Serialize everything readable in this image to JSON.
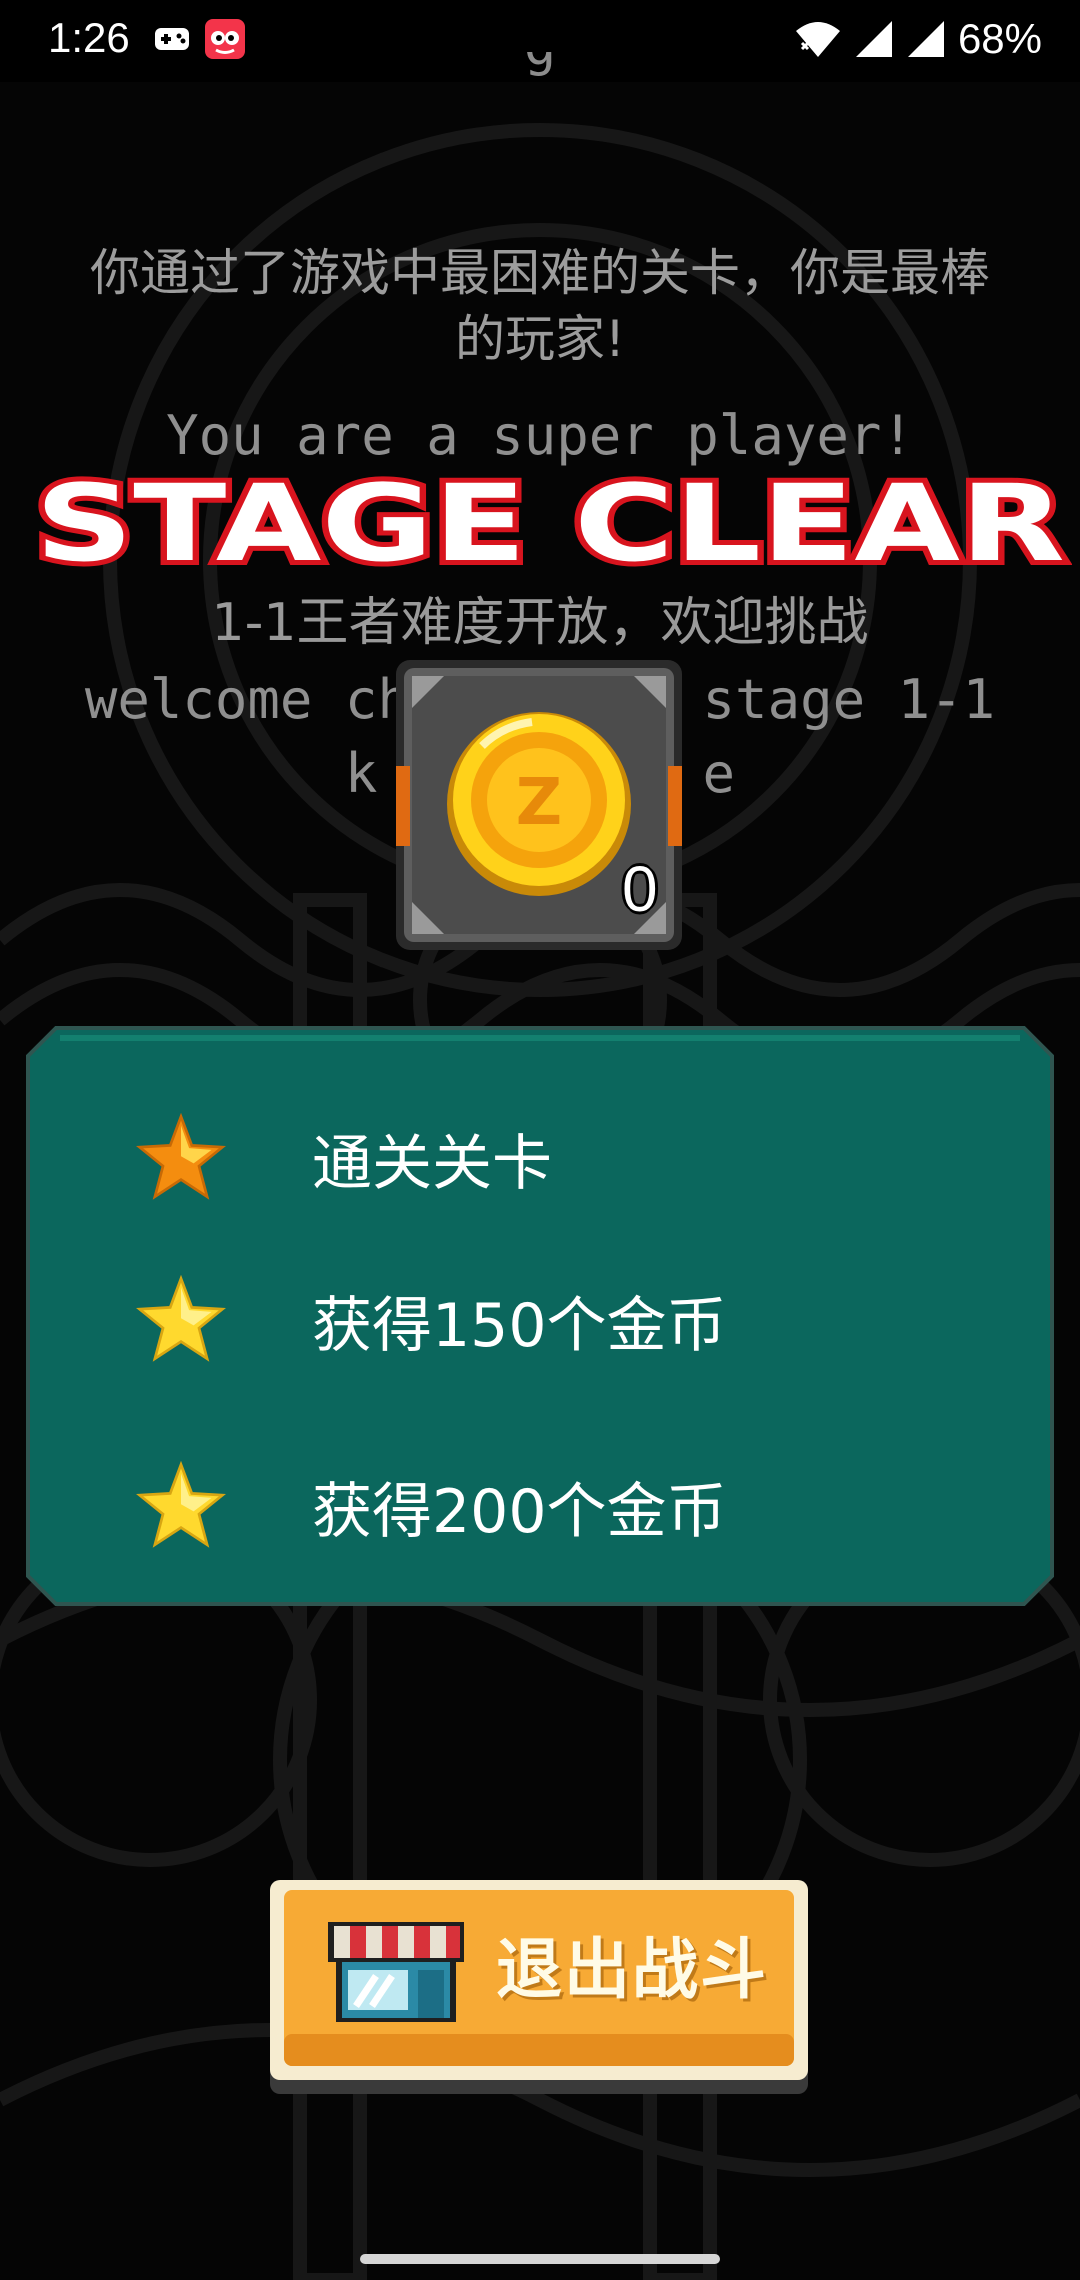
{
  "status_bar": {
    "time": "1:26",
    "battery": "68%"
  },
  "messages": {
    "top_cut": "g",
    "clear_hardest_cn": "你通过了游戏中最困难的关卡，你是最棒的玩家!",
    "super_player_en": "You are a super player!",
    "unlock_cn": "1-1王者难度开放，欢迎挑战",
    "welcome_en": "welcome ch         stage 1-1",
    "welcome_en_2": "k          e"
  },
  "banner": {
    "title": "STAGE CLEAR"
  },
  "reward": {
    "coin_count": "0"
  },
  "objectives": [
    {
      "label": "通关关卡",
      "star": "star-icon"
    },
    {
      "label": "获得150个金币",
      "star": "star-icon"
    },
    {
      "label": "获得200个金币",
      "star": "star-icon"
    }
  ],
  "exit_button": {
    "label": "退出战斗",
    "icon": "shop-icon"
  },
  "colors": {
    "panel": "#0b675d",
    "panel_border": "#2f5550",
    "button": "#f7aa35",
    "banner_fill": "#ffffff",
    "banner_stroke": "#d8141e"
  }
}
